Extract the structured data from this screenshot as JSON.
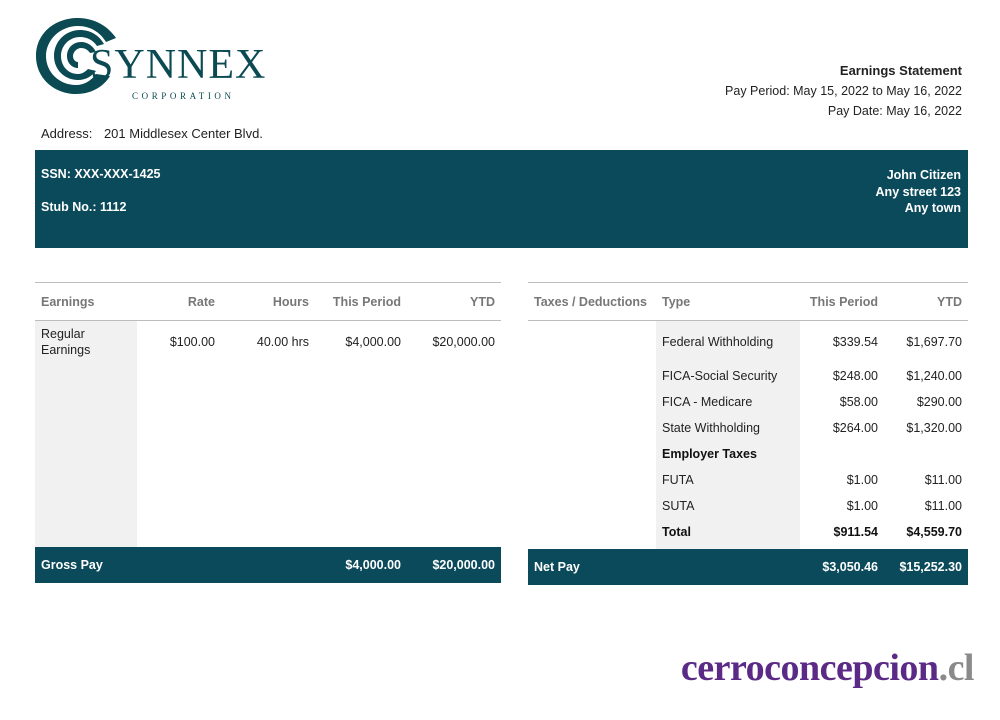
{
  "company": {
    "name": "SYNNEX",
    "subtitle": "CORPORATION",
    "brand_color": "#0b4a5a"
  },
  "statement": {
    "title": "Earnings Statement",
    "pay_period": "Pay Period: May 15, 2022 to May 16, 2022",
    "pay_date": "Pay Date: May 16, 2022"
  },
  "address": {
    "label": "Address:",
    "value": "201 Middlesex Center Blvd."
  },
  "band": {
    "ssn": "SSN: XXX-XXX-1425",
    "stub": "Stub No.: 1112",
    "employee_name": "John Citizen",
    "employee_street": "Any street 123",
    "employee_town": "Any town"
  },
  "earnings": {
    "headers": [
      "Earnings",
      "Rate",
      "Hours",
      "This Period",
      "YTD"
    ],
    "rows": [
      {
        "label": "Regular Earnings",
        "rate": "$100.00",
        "hours": "40.00 hrs",
        "period": "$4,000.00",
        "ytd": "$20,000.00"
      }
    ],
    "footer": {
      "label": "Gross Pay",
      "period": "$4,000.00",
      "ytd": "$20,000.00"
    }
  },
  "taxes": {
    "headers": [
      "Taxes / Deductions",
      "Type",
      "This Period",
      "YTD"
    ],
    "rows": [
      {
        "type": "Federal Withholding",
        "period": "$339.54",
        "ytd": "$1,697.70",
        "bold": false
      },
      {
        "type": "FICA-Social Security",
        "period": "$248.00",
        "ytd": "$1,240.00",
        "bold": false
      },
      {
        "type": "FICA - Medicare",
        "period": "$58.00",
        "ytd": "$290.00",
        "bold": false
      },
      {
        "type": "State Withholding",
        "period": "$264.00",
        "ytd": "$1,320.00",
        "bold": false
      },
      {
        "type": "Employer Taxes",
        "period": "",
        "ytd": "",
        "bold": true
      },
      {
        "type": "FUTA",
        "period": "$1.00",
        "ytd": "$11.00",
        "bold": false
      },
      {
        "type": "SUTA",
        "period": "$1.00",
        "ytd": "$11.00",
        "bold": false
      },
      {
        "type": "Total",
        "period": "$911.54",
        "ytd": "$4,559.70",
        "bold": true
      }
    ],
    "footer": {
      "label": "Net Pay",
      "period": "$3,050.46",
      "ytd": "$15,252.30"
    }
  },
  "watermark": {
    "main": "cerroconcepcion",
    "tld": ".cl"
  }
}
